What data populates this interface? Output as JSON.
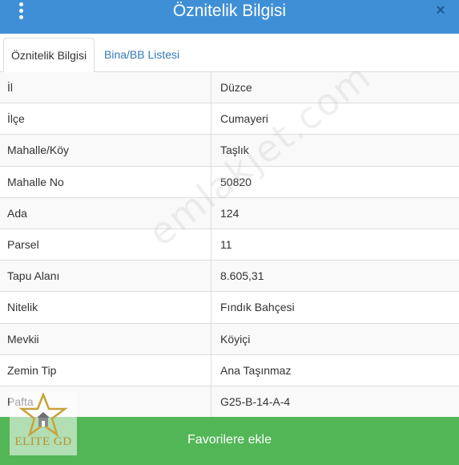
{
  "header": {
    "title": "Öznitelik Bilgisi",
    "menu_icon": "kebab-menu-icon",
    "close_icon": "close-icon",
    "close_glyph": "×",
    "background_color": "#3f8fd6"
  },
  "tabs": [
    {
      "label": "Öznitelik Bilgisi",
      "active": true
    },
    {
      "label": "Bina/BB Listesi",
      "active": false
    }
  ],
  "attributes": [
    {
      "label": "İl",
      "value": "Düzce"
    },
    {
      "label": "İlçe",
      "value": "Cumayeri"
    },
    {
      "label": "Mahalle/Köy",
      "value": "Taşlık"
    },
    {
      "label": "Mahalle No",
      "value": "50820"
    },
    {
      "label": "Ada",
      "value": "124"
    },
    {
      "label": "Parsel",
      "value": "11"
    },
    {
      "label": "Tapu Alanı",
      "value": "8.605,31"
    },
    {
      "label": "Nitelik",
      "value": "Fındık Bahçesi"
    },
    {
      "label": "Mevkii",
      "value": "Köyiçi"
    },
    {
      "label": "Zemin Tip",
      "value": "Ana Taşınmaz"
    },
    {
      "label": "Pafta",
      "value": "G25-B-14-A-4"
    }
  ],
  "footer": {
    "favorite_button_label": "Favorilere ekle",
    "button_color": "#52b656"
  },
  "watermark": {
    "text": "emlakjet.com"
  },
  "logo": {
    "text": "ELITE GD",
    "icon": "star-house-logo-icon"
  }
}
